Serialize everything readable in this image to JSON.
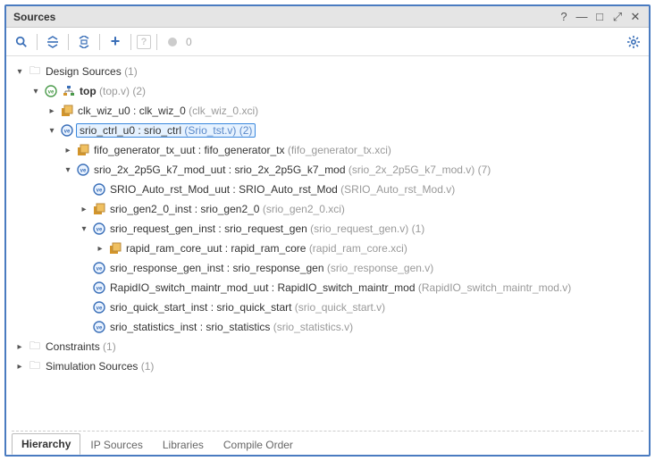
{
  "window": {
    "title": "Sources"
  },
  "toolbar": {
    "question_label": "?",
    "count_badge": "0"
  },
  "tabs": {
    "hierarchy": "Hierarchy",
    "ip_sources": "IP Sources",
    "libraries": "Libraries",
    "compile_order": "Compile Order"
  },
  "tree": {
    "design_sources": {
      "label": "Design Sources",
      "count": "(1)"
    },
    "top": {
      "name": "top",
      "file": "(top.v)",
      "count": "(2)"
    },
    "clk_wiz": {
      "inst": "clk_wiz_u0",
      "mod": "clk_wiz_0",
      "file": "(clk_wiz_0.xci)"
    },
    "srio_ctrl": {
      "inst": "srio_ctrl_u0",
      "mod": "srio_ctrl",
      "file": "(Srio_tst.v)",
      "count": "(2)"
    },
    "fifo_gen": {
      "inst": "fifo_generator_tx_uut",
      "mod": "fifo_generator_tx",
      "file": "(fifo_generator_tx.xci)"
    },
    "srio_2x": {
      "inst": "srio_2x_2p5G_k7_mod_uut",
      "mod": "srio_2x_2p5G_k7_mod",
      "file": "(srio_2x_2p5G_k7_mod.v)",
      "count": "(7)"
    },
    "auto_rst": {
      "inst": "SRIO_Auto_rst_Mod_uut",
      "mod": "SRIO_Auto_rst_Mod",
      "file": "(SRIO_Auto_rst_Mod.v)"
    },
    "gen2": {
      "inst": "srio_gen2_0_inst",
      "mod": "srio_gen2_0",
      "file": "(srio_gen2_0.xci)"
    },
    "req_gen": {
      "inst": "srio_request_gen_inst",
      "mod": "srio_request_gen",
      "file": "(srio_request_gen.v)",
      "count": "(1)"
    },
    "rapid_ram": {
      "inst": "rapid_ram_core_uut",
      "mod": "rapid_ram_core",
      "file": "(rapid_ram_core.xci)"
    },
    "resp_gen": {
      "inst": "srio_response_gen_inst",
      "mod": "srio_response_gen",
      "file": "(srio_response_gen.v)"
    },
    "switch_maintr": {
      "inst": "RapidIO_switch_maintr_mod_uut",
      "mod": "RapidIO_switch_maintr_mod",
      "file": "(RapidIO_switch_maintr_mod.v)"
    },
    "quick_start": {
      "inst": "srio_quick_start_inst",
      "mod": "srio_quick_start",
      "file": "(srio_quick_start.v)"
    },
    "statistics": {
      "inst": "srio_statistics_inst",
      "mod": "srio_statistics",
      "file": "(srio_statistics.v)"
    },
    "constraints": {
      "label": "Constraints",
      "count": "(1)"
    },
    "sim_sources": {
      "label": "Simulation Sources",
      "count": "(1)"
    }
  }
}
